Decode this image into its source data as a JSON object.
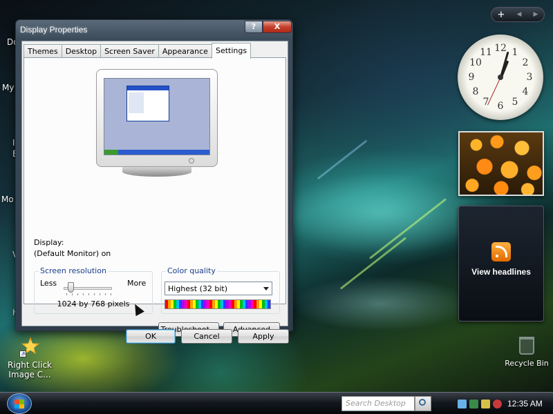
{
  "desktop": {
    "left_fragments": [
      "Do",
      "My",
      "I",
      "E",
      "Mo",
      "V",
      "H"
    ],
    "shortcut": {
      "label": "Right Click Image C..."
    },
    "recycle_bin": {
      "label": "Recycle Bin"
    }
  },
  "sidebar": {
    "controls": [
      "+",
      "◀",
      "▶"
    ],
    "clock_numbers": [
      "12",
      "1",
      "2",
      "3",
      "4",
      "5",
      "6",
      "7",
      "8",
      "9",
      "10",
      "11"
    ],
    "feeds": {
      "label": "View headlines"
    }
  },
  "dialog": {
    "title": "Display Properties",
    "caption_buttons": {
      "help": "?",
      "close": "X"
    },
    "tabs": [
      {
        "label": "Themes"
      },
      {
        "label": "Desktop"
      },
      {
        "label": "Screen Saver"
      },
      {
        "label": "Appearance"
      },
      {
        "label": "Settings"
      }
    ],
    "active_tab": "Settings",
    "display": {
      "label": "Display:",
      "value": "(Default Monitor) on"
    },
    "screen_resolution": {
      "legend": "Screen resolution",
      "less": "Less",
      "more": "More",
      "value": "1024 by 768 pixels"
    },
    "color_quality": {
      "legend": "Color quality",
      "selected": "Highest (32 bit)"
    },
    "buttons": {
      "troubleshoot": "Troubleshoot...",
      "advanced": "Advanced",
      "ok": "OK",
      "cancel": "Cancel",
      "apply": "Apply"
    }
  },
  "taskbar": {
    "search_placeholder": "Search Desktop",
    "clock": "12:35 AM"
  },
  "colors": {
    "accent_blue": "#1a3d8c",
    "close_red": "#c4402c"
  }
}
